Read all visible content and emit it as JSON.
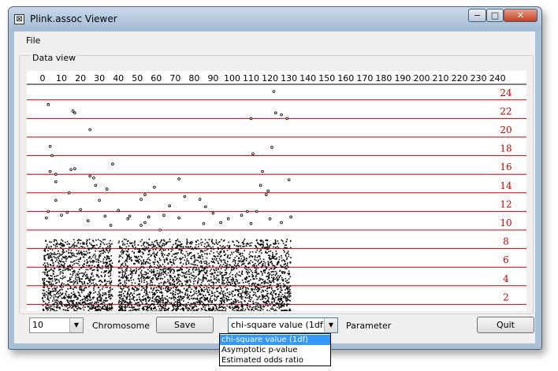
{
  "window": {
    "title": "Plink.assoc Viewer",
    "minimize": "−",
    "maximize": "□",
    "close": "✕"
  },
  "menu": {
    "file": "File"
  },
  "data_view": {
    "label": "Data view"
  },
  "chart_data": {
    "type": "scatter",
    "title": "",
    "xlabel": "",
    "ylabel": "",
    "xlim": [
      0,
      245
    ],
    "ylim": [
      0,
      26
    ],
    "x_ticks": [
      0,
      10,
      20,
      30,
      40,
      50,
      60,
      70,
      80,
      90,
      100,
      110,
      120,
      130,
      140,
      150,
      160,
      170,
      180,
      190,
      200,
      210,
      220,
      230,
      240
    ],
    "y_ticks": [
      2,
      4,
      6,
      8,
      10,
      12,
      14,
      16,
      18,
      20,
      22,
      24
    ],
    "colors": {
      "points": "#000000",
      "gridlines": "#cc0000",
      "tick_labels": "#cc0000"
    },
    "points": [
      [
        3,
        23.5
      ],
      [
        4,
        19
      ],
      [
        5,
        18
      ],
      [
        4,
        16.3
      ],
      [
        7,
        16
      ],
      [
        7,
        15.2
      ],
      [
        7,
        13.2
      ],
      [
        3,
        12
      ],
      [
        2,
        11.3
      ],
      [
        15,
        16.5
      ],
      [
        17,
        16.6
      ],
      [
        16,
        22.8
      ],
      [
        17,
        22.6
      ],
      [
        14,
        14
      ],
      [
        10,
        11.6
      ],
      [
        13,
        11.9
      ],
      [
        20,
        12.2
      ],
      [
        25,
        20.8
      ],
      [
        25,
        15.8
      ],
      [
        27,
        15.6
      ],
      [
        28,
        14.8
      ],
      [
        30,
        13.2
      ],
      [
        34,
        14.4
      ],
      [
        37,
        17.1
      ],
      [
        33,
        11.5
      ],
      [
        24,
        11
      ],
      [
        36,
        10.5
      ],
      [
        45,
        11.2
      ],
      [
        52,
        10.5
      ],
      [
        54,
        10.8
      ],
      [
        56,
        11.4
      ],
      [
        52,
        13.3
      ],
      [
        54,
        13.8
      ],
      [
        59,
        14.6
      ],
      [
        62,
        10
      ],
      [
        64,
        11.6
      ],
      [
        72,
        11.3
      ],
      [
        75,
        13.6
      ],
      [
        83,
        13.3
      ],
      [
        86,
        12.5
      ],
      [
        90,
        11.8
      ],
      [
        85,
        10.7
      ],
      [
        94,
        10.8
      ],
      [
        98,
        11.2
      ],
      [
        105,
        11.6
      ],
      [
        108,
        12
      ],
      [
        110,
        10.7
      ],
      [
        110,
        22
      ],
      [
        111,
        18.2
      ],
      [
        113,
        12
      ],
      [
        115,
        14.8
      ],
      [
        116,
        16.3
      ],
      [
        118,
        13.8
      ],
      [
        119,
        14.2
      ],
      [
        120,
        11.2
      ],
      [
        121,
        18.9
      ],
      [
        122,
        24.9
      ],
      [
        123,
        22.6
      ],
      [
        126,
        22.4
      ],
      [
        129,
        22
      ],
      [
        130,
        15.4
      ],
      [
        126,
        10.8
      ],
      [
        131,
        11.4
      ],
      [
        72,
        15.5
      ],
      [
        40,
        12.1
      ],
      [
        46,
        11.5
      ],
      [
        67,
        12.6
      ]
    ],
    "dense_cloud": {
      "x_ranges": [
        [
          0,
          37
        ],
        [
          40,
          131
        ]
      ],
      "y_range": [
        0,
        9
      ],
      "description_free_note": ""
    }
  },
  "controls": {
    "chromosome_value": "10",
    "chromosome_label": "Chromosome",
    "save": "Save",
    "parameter_value": "chi-square value (1df)",
    "parameter_label": "Parameter",
    "quit": "Quit",
    "arrow": "▼",
    "parameter_options": [
      "chi-square value (1df)",
      "Asymptotic p-value",
      "Estimated odds ratio"
    ]
  }
}
